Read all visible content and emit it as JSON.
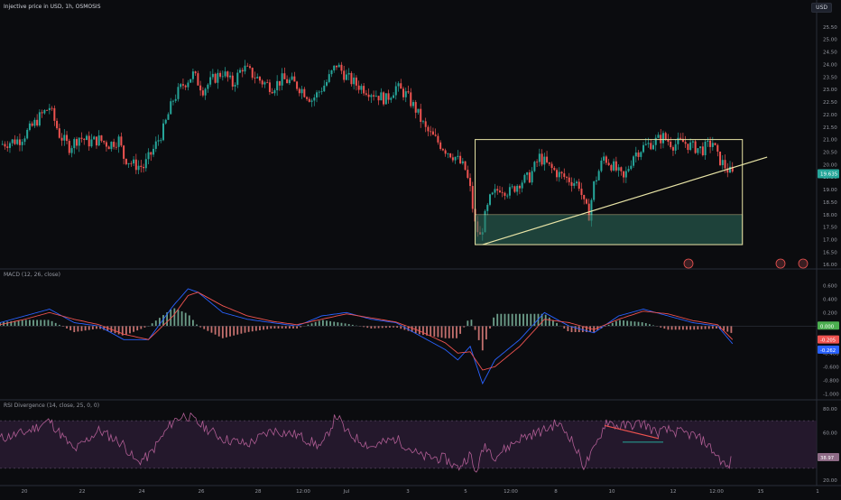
{
  "header": {
    "title": "Injective price in USD, 1h, OSMOSIS",
    "currency": "USD"
  },
  "panes": {
    "macd_label": "MACD (12, 26, close)",
    "rsi_label": "RSI Divergence (14, close, 25, 0, 0)"
  },
  "colors": {
    "background": "#0b0c0f",
    "up": "#26a69a",
    "down": "#ef5350",
    "rectangle": "#e8e4a6",
    "zone": "#2f6f5e",
    "macd_line": "#2962ff",
    "signal_line": "#ef5350",
    "rsi_line": "#b05d94",
    "rsi_band": "#2a1c33"
  },
  "chart_data": [
    {
      "type": "candlestick",
      "title": "Injective price in USD, 1h, OSMOSIS",
      "x_ticks": [
        "20",
        "22",
        "24",
        "26",
        "28",
        "12:00",
        "Jul",
        "3",
        "5",
        "12:00",
        "8",
        "10",
        "12",
        "12:00",
        "15",
        "1"
      ],
      "y_ticks": [
        16.0,
        16.5,
        17.0,
        17.5,
        18.0,
        18.5,
        19.0,
        19.5,
        20.0,
        20.5,
        21.0,
        21.5,
        22.0,
        22.5,
        23.0,
        23.5,
        24.0,
        24.5,
        25.0,
        25.5
      ],
      "ylim": [
        15.9,
        26.0
      ],
      "last_price": "19.635",
      "close_path": [
        [
          0,
          20.8
        ],
        [
          4,
          20.9
        ],
        [
          8,
          21.0
        ],
        [
          12,
          21.4
        ],
        [
          16,
          21.9
        ],
        [
          20,
          22.3
        ],
        [
          24,
          21.2
        ],
        [
          28,
          20.7
        ],
        [
          32,
          21.1
        ],
        [
          36,
          20.9
        ],
        [
          40,
          21.0
        ],
        [
          44,
          20.8
        ],
        [
          48,
          21.0
        ],
        [
          50,
          20.3
        ],
        [
          54,
          20.0
        ],
        [
          58,
          19.9
        ],
        [
          62,
          20.6
        ],
        [
          66,
          21.4
        ],
        [
          70,
          22.6
        ],
        [
          74,
          23.2
        ],
        [
          78,
          23.6
        ],
        [
          82,
          23.0
        ],
        [
          86,
          23.4
        ],
        [
          90,
          23.7
        ],
        [
          94,
          23.2
        ],
        [
          98,
          23.9
        ],
        [
          102,
          23.6
        ],
        [
          106,
          23.3
        ],
        [
          110,
          23.1
        ],
        [
          114,
          23.4
        ],
        [
          118,
          23.3
        ],
        [
          122,
          23.0
        ],
        [
          126,
          22.6
        ],
        [
          128,
          22.8
        ],
        [
          132,
          23.3
        ],
        [
          136,
          24.0
        ],
        [
          140,
          23.5
        ],
        [
          144,
          23.2
        ],
        [
          148,
          23.0
        ],
        [
          152,
          22.8
        ],
        [
          156,
          22.6
        ],
        [
          160,
          23.1
        ],
        [
          164,
          22.8
        ],
        [
          168,
          22.2
        ],
        [
          172,
          21.4
        ],
        [
          176,
          21.0
        ],
        [
          180,
          20.6
        ],
        [
          184,
          20.3
        ],
        [
          188,
          19.8
        ],
        [
          190,
          19.0
        ],
        [
          192,
          17.6
        ],
        [
          194,
          17.1
        ],
        [
          196,
          17.9
        ],
        [
          198,
          18.6
        ],
        [
          202,
          19.1
        ],
        [
          206,
          18.9
        ],
        [
          210,
          19.3
        ],
        [
          214,
          19.5
        ],
        [
          218,
          20.3
        ],
        [
          222,
          19.9
        ],
        [
          226,
          19.6
        ],
        [
          230,
          19.4
        ],
        [
          234,
          19.2
        ],
        [
          236,
          18.4
        ],
        [
          238,
          18.0
        ],
        [
          240,
          19.2
        ],
        [
          244,
          20.3
        ],
        [
          248,
          19.9
        ],
        [
          252,
          19.4
        ],
        [
          256,
          20.4
        ],
        [
          260,
          20.7
        ],
        [
          264,
          20.9
        ],
        [
          268,
          21.1
        ],
        [
          272,
          20.8
        ],
        [
          276,
          20.9
        ],
        [
          280,
          20.7
        ],
        [
          284,
          20.6
        ],
        [
          288,
          20.9
        ],
        [
          290,
          20.3
        ],
        [
          294,
          19.8
        ],
        [
          296,
          19.6
        ]
      ],
      "zone": {
        "x": [
          192,
          300
        ],
        "y": [
          16.8,
          18.0
        ]
      },
      "range_box": {
        "x": [
          192,
          300
        ],
        "y": [
          16.8,
          21.0
        ]
      },
      "trendline": [
        [
          195,
          16.8
        ],
        [
          310,
          20.3
        ]
      ]
    },
    {
      "type": "line",
      "title": "MACD (12, 26, close)",
      "y_ticks": [
        0.6,
        0.4,
        0.2,
        0.0,
        -0.2,
        -0.4,
        -0.6,
        -0.8,
        -1.0
      ],
      "ylim": [
        -1.05,
        0.75
      ],
      "value_labels": [
        "0.000",
        "-0.205",
        "-0.262"
      ],
      "series": [
        {
          "name": "MACD",
          "x": [
            0,
            10,
            20,
            30,
            40,
            50,
            60,
            70,
            76,
            80,
            90,
            100,
            110,
            120,
            130,
            140,
            150,
            160,
            170,
            180,
            185,
            190,
            195,
            200,
            210,
            220,
            230,
            240,
            250,
            260,
            270,
            280,
            290,
            296
          ],
          "values": [
            0.05,
            0.15,
            0.25,
            0.05,
            0.0,
            -0.2,
            -0.2,
            0.3,
            0.55,
            0.5,
            0.2,
            0.1,
            0.05,
            0.0,
            0.15,
            0.2,
            0.1,
            0.05,
            -0.15,
            -0.35,
            -0.5,
            -0.3,
            -0.85,
            -0.5,
            -0.2,
            0.2,
            0.0,
            -0.1,
            0.15,
            0.25,
            0.15,
            0.05,
            0.0,
            -0.26
          ]
        },
        {
          "name": "Signal",
          "x": [
            0,
            10,
            20,
            30,
            40,
            50,
            60,
            70,
            76,
            80,
            90,
            100,
            110,
            120,
            130,
            140,
            150,
            160,
            170,
            180,
            185,
            190,
            195,
            200,
            210,
            220,
            230,
            240,
            250,
            260,
            270,
            280,
            290,
            296
          ],
          "values": [
            0.02,
            0.1,
            0.2,
            0.1,
            0.02,
            -0.12,
            -0.2,
            0.15,
            0.45,
            0.5,
            0.3,
            0.15,
            0.07,
            0.02,
            0.1,
            0.18,
            0.12,
            0.06,
            -0.08,
            -0.25,
            -0.4,
            -0.38,
            -0.65,
            -0.6,
            -0.3,
            0.1,
            0.05,
            -0.05,
            0.1,
            0.22,
            0.18,
            0.08,
            0.02,
            -0.2
          ]
        }
      ]
    },
    {
      "type": "line",
      "title": "RSI Divergence (14, close, 25, 0, 0)",
      "y_ticks": [
        80.0,
        60.0,
        40.0,
        20.0
      ],
      "ylim": [
        17,
        83
      ],
      "value_labels": [
        "38.97"
      ],
      "series": [
        {
          "name": "RSI",
          "x": [
            0,
            10,
            20,
            30,
            40,
            50,
            55,
            60,
            70,
            75,
            80,
            90,
            100,
            110,
            120,
            130,
            136,
            140,
            150,
            160,
            170,
            180,
            185,
            190,
            192,
            196,
            200,
            210,
            220,
            225,
            230,
            236,
            240,
            245,
            250,
            260,
            265,
            270,
            280,
            285,
            290,
            294,
            296
          ],
          "values": [
            55,
            60,
            70,
            45,
            62,
            50,
            35,
            40,
            70,
            75,
            68,
            55,
            50,
            62,
            58,
            48,
            75,
            60,
            48,
            55,
            40,
            38,
            30,
            42,
            25,
            50,
            40,
            55,
            62,
            68,
            58,
            32,
            45,
            70,
            65,
            68,
            60,
            62,
            58,
            52,
            40,
            30,
            38.97
          ]
        }
      ]
    }
  ]
}
